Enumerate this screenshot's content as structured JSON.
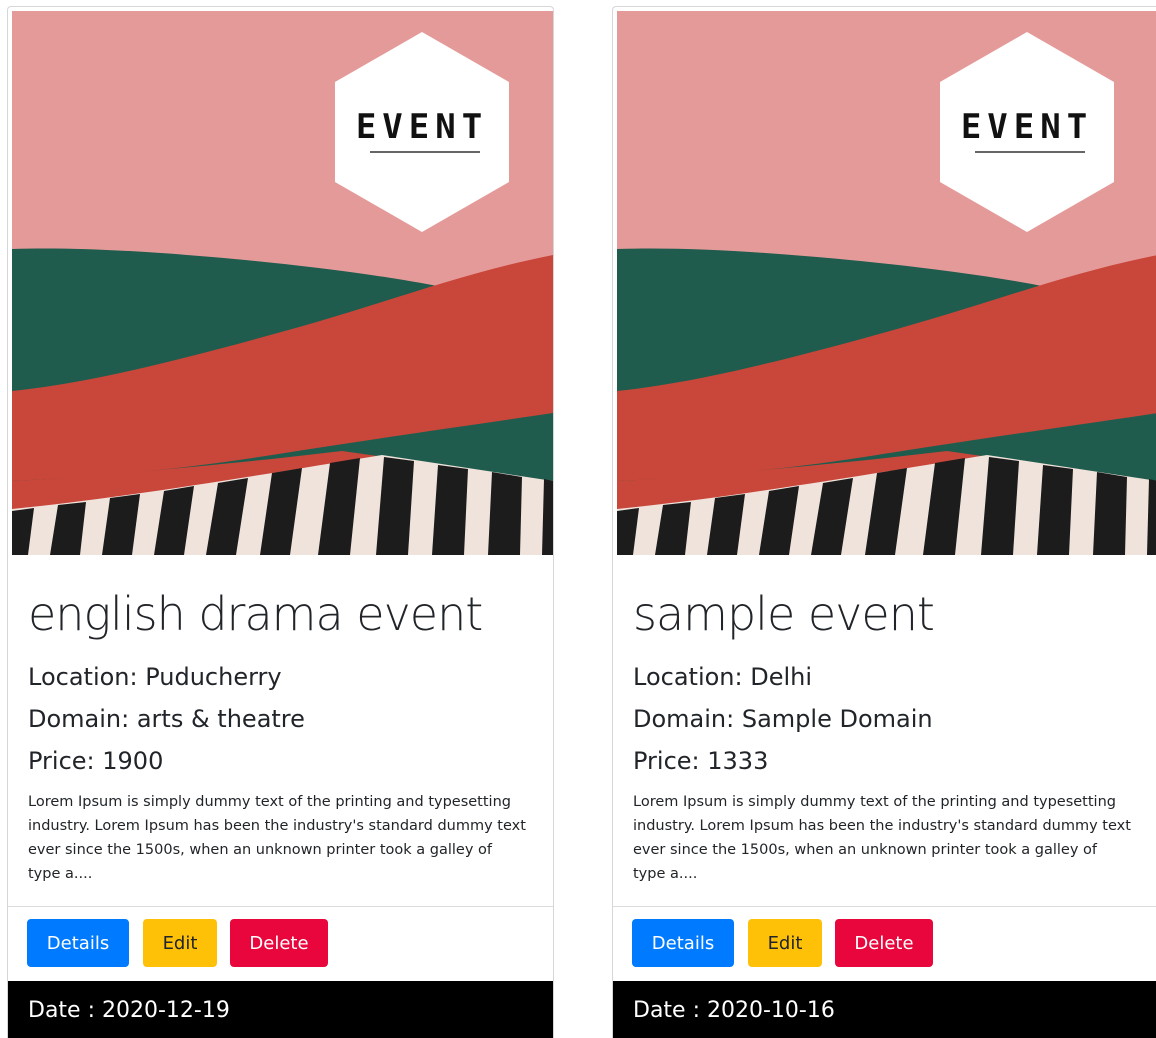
{
  "poster": {
    "badge_text": "EVENT",
    "colors": {
      "sky": "#e59a9a",
      "green": "#1f5c4d",
      "red": "#c9473a",
      "stripe_dark": "#1c1c1c",
      "stripe_light": "#efe3dc",
      "badge": "#ffffff"
    }
  },
  "cards": [
    {
      "title": "english drama event",
      "location": "Location: Puducherry",
      "domain": "Domain: arts & theatre",
      "price": "Price: 1900",
      "description": "Lorem Ipsum is simply dummy text of the printing and typesetting industry. Lorem Ipsum has been the industry's standard dummy text ever since the 1500s, when an unknown printer took a galley of type a....",
      "buttons": {
        "details": "Details",
        "edit": "Edit",
        "delete": "Delete"
      },
      "date": "Date : 2020-12-19"
    },
    {
      "title": "sample event",
      "location": "Location: Delhi",
      "domain": "Domain: Sample Domain",
      "price": "Price: 1333",
      "description": "Lorem Ipsum is simply dummy text of the printing and typesetting industry. Lorem Ipsum has been the industry's standard dummy text ever since the 1500s, when an unknown printer took a galley of type a....",
      "buttons": {
        "details": "Details",
        "edit": "Edit",
        "delete": "Delete"
      },
      "date": "Date : 2020-10-16"
    }
  ],
  "colors": {
    "primary": "#007bff",
    "warning": "#ffc107",
    "danger": "#e8063c",
    "date_bar": "#000000"
  }
}
